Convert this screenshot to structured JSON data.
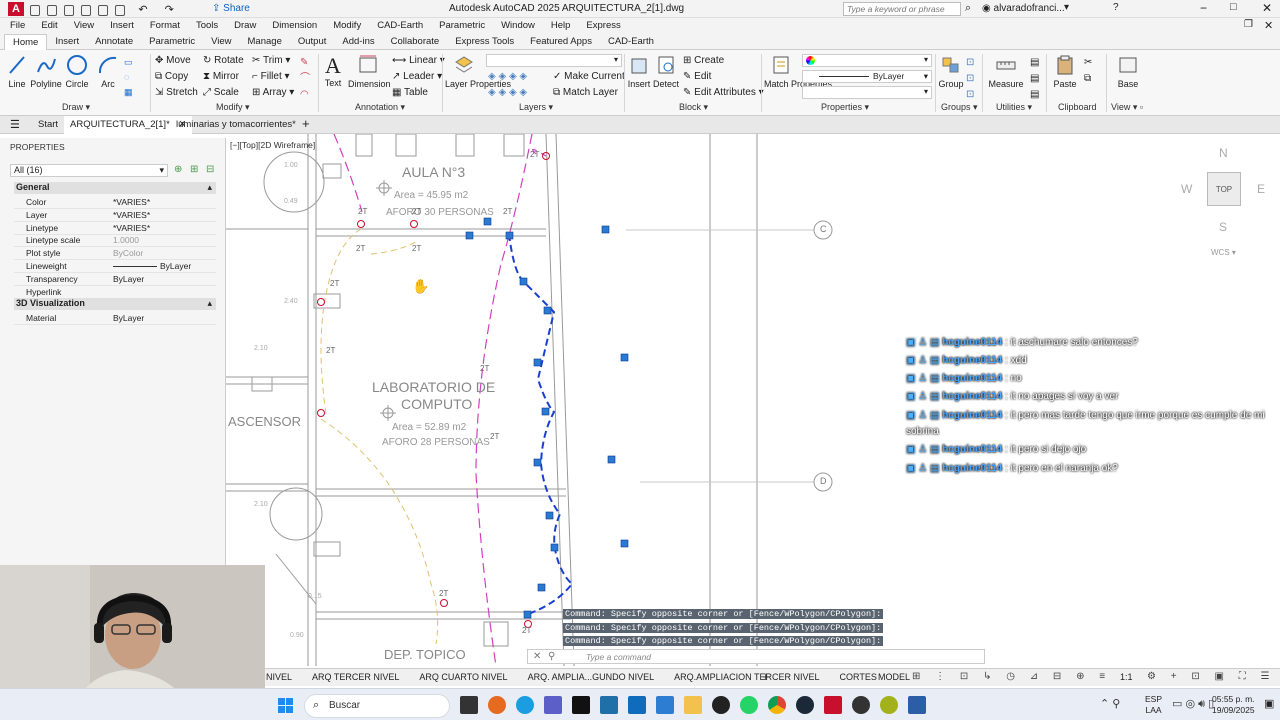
{
  "titlebar": {
    "app_icon": "A",
    "share": "Share",
    "title": "Autodesk AutoCAD 2025   ARQUITECTURA_2[1].dwg",
    "search_placeholder": "Type a keyword or phrase",
    "user": "alvaradofranci..."
  },
  "menubar": {
    "items": [
      "File",
      "Edit",
      "View",
      "Insert",
      "Format",
      "Tools",
      "Draw",
      "Dimension",
      "Modify",
      "CAD-Earth",
      "Parametric",
      "Window",
      "Help",
      "Express"
    ]
  },
  "ribbon_tabs": {
    "items": [
      "Home",
      "Insert",
      "Annotate",
      "Parametric",
      "View",
      "Manage",
      "Output",
      "Add-ins",
      "Collaborate",
      "Express Tools",
      "Featured Apps",
      "CAD-Earth"
    ],
    "active": "Home"
  },
  "ribbon": {
    "draw": {
      "line": "Line",
      "polyline": "Polyline",
      "circle": "Circle",
      "arc": "Arc",
      "label": "Draw"
    },
    "modify": {
      "move": "Move",
      "rotate": "Rotate",
      "trim": "Trim",
      "copy": "Copy",
      "mirror": "Mirror",
      "fillet": "Fillet",
      "stretch": "Stretch",
      "scale": "Scale",
      "array": "Array",
      "label": "Modify"
    },
    "annotation": {
      "text": "Text",
      "dimension": "Dimension",
      "linear": "Linear",
      "leader": "Leader",
      "table": "Table",
      "label": "Annotation"
    },
    "layers": {
      "layer_properties": "Layer Properties",
      "make_current": "Make Current",
      "match_layer": "Match Layer",
      "label": "Layers"
    },
    "block": {
      "insert": "Insert",
      "detect": "Detect",
      "create": "Create",
      "edit": "Edit",
      "edit_attributes": "Edit Attributes",
      "label": "Block"
    },
    "properties": {
      "match_properties": "Match Properties",
      "bylayer": "ByLayer",
      "label": "Properties"
    },
    "groups": {
      "group": "Group",
      "label": "Groups"
    },
    "utilities": {
      "measure": "Measure",
      "label": "Utilities"
    },
    "clipboard": {
      "paste": "Paste",
      "label": "Clipboard"
    },
    "view": {
      "base": "Base",
      "label": "View"
    }
  },
  "doctabs": {
    "start": "Start",
    "active": "ARQUITECTURA_2[1]*",
    "other": "luminarias y tomacorrientes*"
  },
  "properties_panel": {
    "title": "PROPERTIES",
    "selection": "All (16)",
    "general_header": "General",
    "rows": [
      {
        "k": "Color",
        "v": "*VARIES*"
      },
      {
        "k": "Layer",
        "v": "*VARIES*"
      },
      {
        "k": "Linetype",
        "v": "*VARIES*"
      },
      {
        "k": "Linetype scale",
        "v": "1.0000"
      },
      {
        "k": "Plot style",
        "v": "ByColor"
      },
      {
        "k": "Lineweight",
        "v": "ByLayer"
      },
      {
        "k": "Transparency",
        "v": "ByLayer"
      },
      {
        "k": "Hyperlink",
        "v": ""
      }
    ],
    "viz_header": "3D Visualization",
    "viz_rows": [
      {
        "k": "Material",
        "v": "ByLayer"
      }
    ]
  },
  "viewport": {
    "label": "[−][Top][2D Wireframe]",
    "compass_n": "N",
    "compass_s": "S",
    "compass_e": "E",
    "compass_w": "W",
    "top": "TOP",
    "wcs": "WCS"
  },
  "drawing": {
    "room1": "AULA N°3",
    "room1_area": "Area = 45.95 m2",
    "room1_aforo": "AFORO  30 PERSONAS",
    "room2": "LABORATORIO DE",
    "room2b": "COMPUTO",
    "room2_area": "Area = 52.89 m2",
    "room2_aforo": "AFORO  28 PERSONAS",
    "ascensor": "ASCENSOR",
    "topico": "DEP. TOPICO",
    "grid_c": "C",
    "grid_d": "D",
    "dim1": "2.10",
    "dim2": "2.40",
    "dim3": "2.10",
    "dim4": "2.10",
    "dim5": "0.15",
    "dim6": "0.90",
    "dim7": "1.00",
    "dim8": "0.49",
    "tag": "2T"
  },
  "chat": [
    {
      "user": "hcguine0114",
      "msg": "it aschumare salo entonces?"
    },
    {
      "user": "hcguine0114",
      "msg": "xdd"
    },
    {
      "user": "hcguine0114",
      "msg": "no"
    },
    {
      "user": "hcguine0114",
      "msg": "it no apages si voy a ver"
    },
    {
      "user": "hcguine0114",
      "msg": "it pero mas tarde tengo que irme porque es cumple de mi"
    },
    {
      "user": "",
      "msg": "sobrina"
    },
    {
      "user": "hcguine0114",
      "msg": "it pero si dejo ojo"
    },
    {
      "user": "hcguine0114",
      "msg": "it pero en el naranja ok?"
    }
  ],
  "command": {
    "history": [
      "Command: Specify opposite corner or [Fence/WPolygon/CPolygon]:",
      "Command: Specify opposite corner or [Fence/WPolygon/CPolygon]:",
      "Command: Specify opposite corner or [Fence/WPolygon/CPolygon]:"
    ],
    "placeholder": "Type a command"
  },
  "layout_tabs": [
    "NIVEL",
    "ARQ TERCER NIVEL",
    "ARQ CUARTO NIVEL",
    "ARQ. AMPLIA...GUNDO NIVEL",
    "ARQ.AMPLIACION TERCER NIVEL",
    "CORTES"
  ],
  "status": {
    "model": "MODEL",
    "scale": "1:1"
  },
  "taskbar": {
    "search": "Buscar",
    "lang": "ESP",
    "lang2": "LAA",
    "time": "05:55 p. m.",
    "date": "19/09/2025"
  }
}
